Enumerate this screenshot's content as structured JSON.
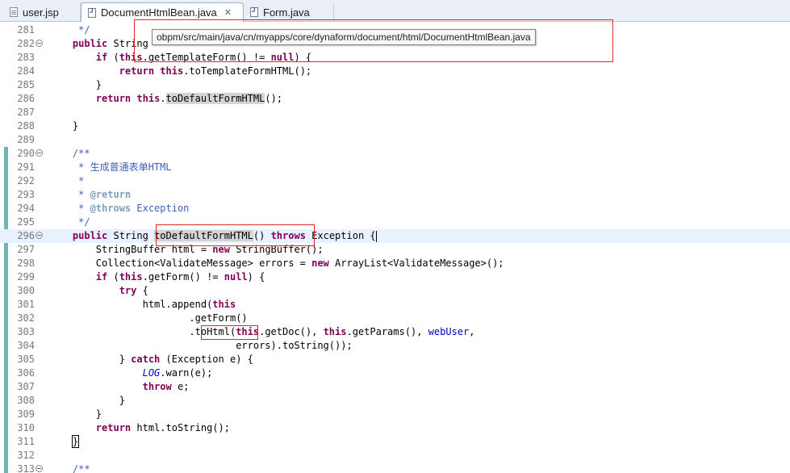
{
  "tabs": [
    {
      "label": "user.jsp",
      "icon": "jsp-file-icon"
    },
    {
      "label": "DocumentHtmlBean.java",
      "icon": "java-file-icon",
      "active": true,
      "close_icon": "close-icon"
    },
    {
      "label": "Form.java",
      "icon": "java-file-icon"
    }
  ],
  "tooltip": {
    "path": "obpm/src/main/java/cn/myapps/core/dynaform/document/html/DocumentHtmlBean.java"
  },
  "editor": {
    "colors": {
      "keyword": "#7f0055",
      "javadoc": "#3f5fbf",
      "javadoc_tag": "#7f9fbf",
      "field": "#0000c0",
      "current_line": "#e8f2fe",
      "annotation_box": "#e8262a"
    },
    "current_line": 296,
    "lines": [
      {
        "n": 281,
        "parts": [
          [
            "cm",
            "     */"
          ]
        ]
      },
      {
        "n": 282,
        "fold": true,
        "parts": [
          [
            "",
            "    "
          ],
          [
            "kw",
            "public"
          ],
          [
            "",
            " String"
          ]
        ]
      },
      {
        "n": 283,
        "parts": [
          [
            "",
            "        "
          ],
          [
            "kw",
            "if"
          ],
          [
            "",
            " ("
          ],
          [
            "kw",
            "this"
          ],
          [
            "",
            ".getTemplateForm() != "
          ],
          [
            "kw",
            "null"
          ],
          [
            "",
            ") {"
          ]
        ]
      },
      {
        "n": 284,
        "parts": [
          [
            "",
            "            "
          ],
          [
            "kw",
            "return"
          ],
          [
            "",
            " "
          ],
          [
            "kw",
            "this"
          ],
          [
            "",
            ".toTemplateFormHTML();"
          ]
        ]
      },
      {
        "n": 285,
        "parts": [
          [
            "",
            "        }"
          ]
        ]
      },
      {
        "n": 286,
        "parts": [
          [
            "",
            "        "
          ],
          [
            "kw",
            "return"
          ],
          [
            "",
            " "
          ],
          [
            "kw",
            "this"
          ],
          [
            "",
            "."
          ],
          [
            "hl",
            "toDefaultFormHTML"
          ],
          [
            "",
            "();"
          ]
        ]
      },
      {
        "n": 287,
        "parts": []
      },
      {
        "n": 288,
        "parts": [
          [
            "",
            "    }"
          ]
        ]
      },
      {
        "n": 289,
        "parts": []
      },
      {
        "n": 290,
        "fold": true,
        "parts": [
          [
            "cm",
            "    /**"
          ]
        ]
      },
      {
        "n": 291,
        "parts": [
          [
            "cm",
            "     * 生成普通表单HTML"
          ]
        ]
      },
      {
        "n": 292,
        "parts": [
          [
            "cm",
            "     *"
          ]
        ]
      },
      {
        "n": 293,
        "parts": [
          [
            "cm",
            "     * "
          ],
          [
            "tg",
            "@return"
          ]
        ]
      },
      {
        "n": 294,
        "parts": [
          [
            "cm",
            "     * "
          ],
          [
            "tg",
            "@throws"
          ],
          [
            "cm",
            " Exception"
          ]
        ]
      },
      {
        "n": 295,
        "parts": [
          [
            "cm",
            "     */"
          ]
        ]
      },
      {
        "n": 296,
        "fold": true,
        "parts": [
          [
            "",
            "    "
          ],
          [
            "kw",
            "public"
          ],
          [
            "",
            " String "
          ],
          [
            "hl",
            "toDefaultFormHTML"
          ],
          [
            "",
            "() "
          ],
          [
            "kw",
            "throws"
          ],
          [
            "",
            " Exception {"
          ],
          [
            "caret",
            ""
          ]
        ]
      },
      {
        "n": 297,
        "parts": [
          [
            "",
            "        StringBuffer html = "
          ],
          [
            "kw",
            "new"
          ],
          [
            "",
            " StringBuffer();"
          ]
        ]
      },
      {
        "n": 298,
        "parts": [
          [
            "",
            "        Collection<ValidateMessage> errors = "
          ],
          [
            "kw",
            "new"
          ],
          [
            "",
            " ArrayList<ValidateMessage>();"
          ]
        ]
      },
      {
        "n": 299,
        "parts": [
          [
            "",
            "        "
          ],
          [
            "kw",
            "if"
          ],
          [
            "",
            " ("
          ],
          [
            "kw",
            "this"
          ],
          [
            "",
            ".getForm() != "
          ],
          [
            "kw",
            "null"
          ],
          [
            "",
            ") {"
          ]
        ]
      },
      {
        "n": 300,
        "parts": [
          [
            "",
            "            "
          ],
          [
            "kw",
            "try"
          ],
          [
            "",
            " {"
          ]
        ]
      },
      {
        "n": 301,
        "parts": [
          [
            "",
            "                html.append("
          ],
          [
            "kw",
            "this"
          ]
        ]
      },
      {
        "n": 302,
        "parts": [
          [
            "",
            "                        .getForm()"
          ]
        ]
      },
      {
        "n": 303,
        "parts": [
          [
            "",
            "                        .toHtml("
          ],
          [
            "kw",
            "this"
          ],
          [
            "",
            ".getDoc(), "
          ],
          [
            "kw",
            "this"
          ],
          [
            "",
            ".getParams(), "
          ],
          [
            "fd",
            "webUser"
          ],
          [
            "",
            ","
          ]
        ]
      },
      {
        "n": 304,
        "parts": [
          [
            "",
            "                                errors).toString());"
          ]
        ]
      },
      {
        "n": 305,
        "parts": [
          [
            "",
            "            } "
          ],
          [
            "kw",
            "catch"
          ],
          [
            "",
            " (Exception e) {"
          ]
        ]
      },
      {
        "n": 306,
        "parts": [
          [
            "",
            "                "
          ],
          [
            "st",
            "LOG"
          ],
          [
            "",
            ".warn(e);"
          ]
        ]
      },
      {
        "n": 307,
        "parts": [
          [
            "",
            "                "
          ],
          [
            "kw",
            "throw"
          ],
          [
            "",
            " e;"
          ]
        ]
      },
      {
        "n": 308,
        "parts": [
          [
            "",
            "            }"
          ]
        ]
      },
      {
        "n": 309,
        "parts": [
          [
            "",
            "        }"
          ]
        ]
      },
      {
        "n": 310,
        "parts": [
          [
            "",
            "        "
          ],
          [
            "kw",
            "return"
          ],
          [
            "",
            " html.toString();"
          ]
        ]
      },
      {
        "n": 311,
        "parts": [
          [
            "",
            "    "
          ],
          [
            "bx",
            "}"
          ]
        ]
      },
      {
        "n": 312,
        "parts": []
      },
      {
        "n": 313,
        "fold": true,
        "parts": [
          [
            "cm",
            "    /**"
          ]
        ]
      }
    ]
  }
}
